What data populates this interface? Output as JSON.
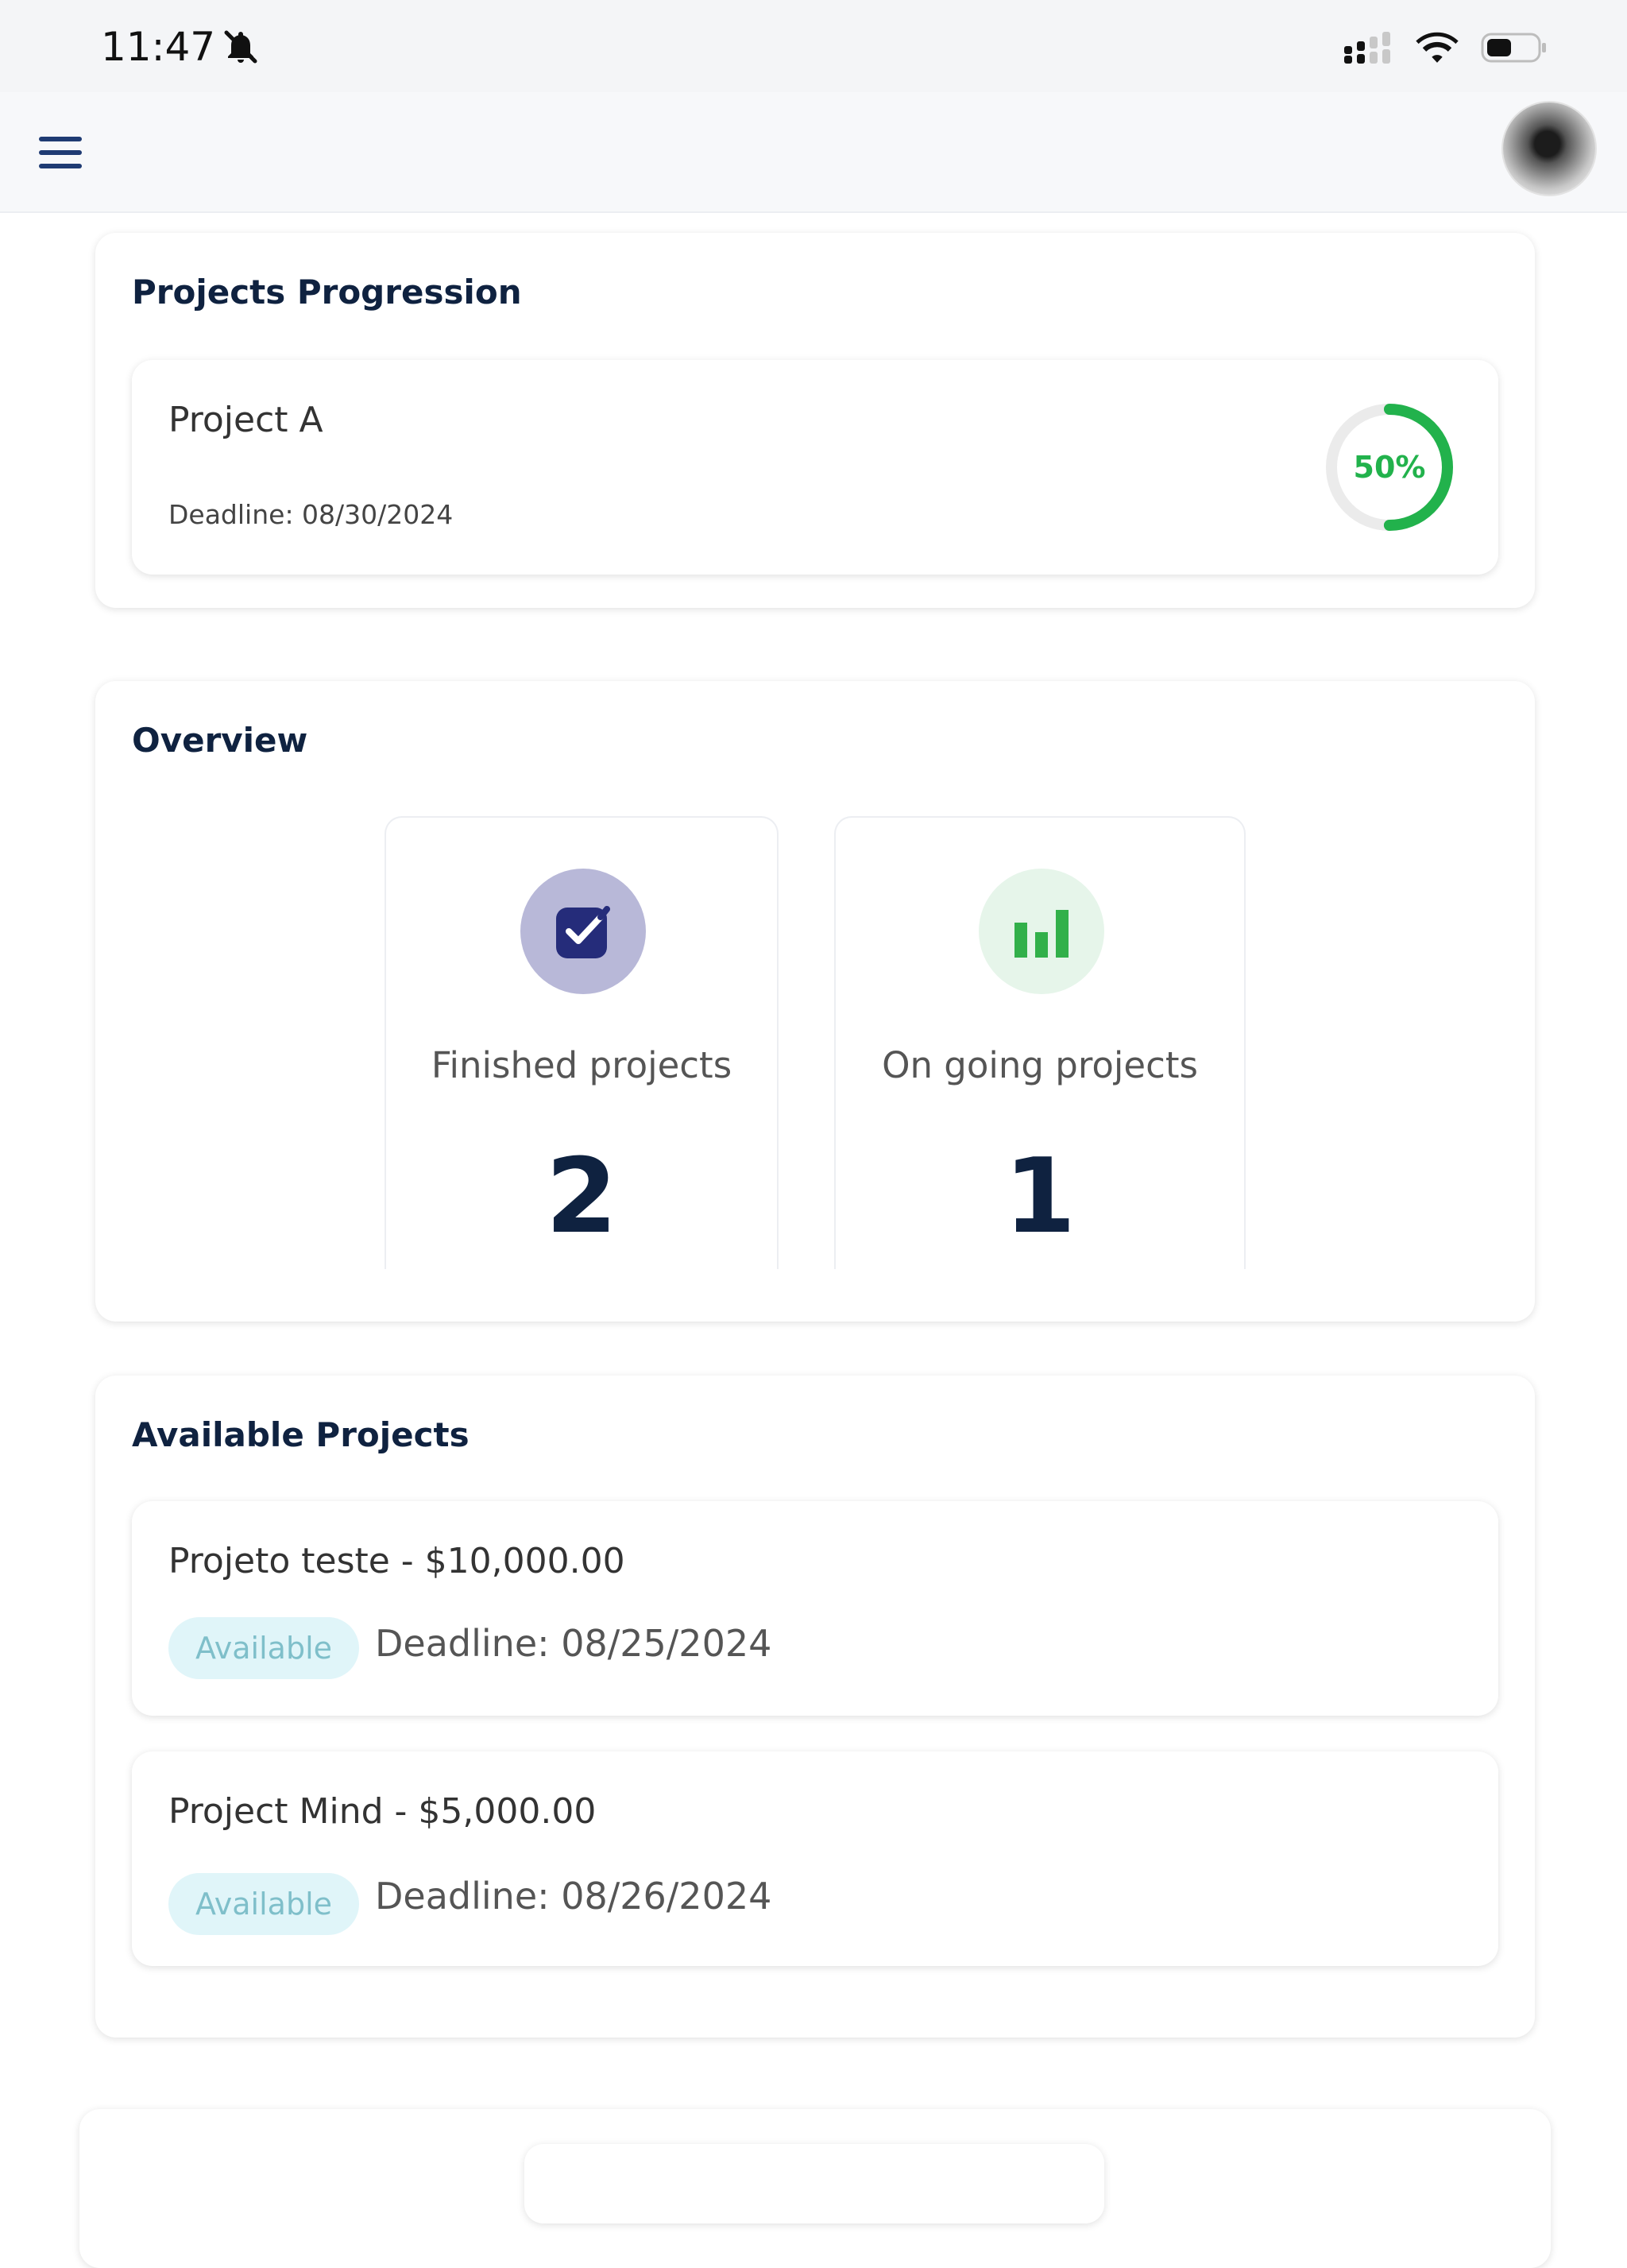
{
  "status_bar": {
    "time": "11:47",
    "icons": [
      "bell-off-icon",
      "signal-icon",
      "wifi-icon",
      "battery-icon"
    ]
  },
  "app_bar": {
    "menu_icon": "hamburger-menu-icon",
    "avatar": "user-avatar"
  },
  "projects_progression": {
    "title": "Projects Progression",
    "items": [
      {
        "name": "Project A",
        "deadline": "Deadline: 08/30/2024",
        "progress_label": "50%",
        "progress": 0.5
      }
    ]
  },
  "overview": {
    "title": "Overview",
    "stats": [
      {
        "label": "Finished projects",
        "value": "2",
        "icon": "checkbox-icon"
      },
      {
        "label": "On going projects",
        "value": "1",
        "icon": "bar-chart-icon"
      }
    ]
  },
  "available_projects": {
    "title": "Available Projects",
    "items": [
      {
        "title": "Projeto teste - $10,000.00",
        "status": "Available",
        "deadline": "Deadline: 08/25/2024"
      },
      {
        "title": "Project Mind - $5,000.00",
        "status": "Available",
        "deadline": "Deadline: 08/26/2024"
      }
    ]
  },
  "colors": {
    "primary_navy": "#0f2240",
    "accent_green": "#22b24c",
    "badge_bg": "#e0f5f9",
    "badge_text": "#7fbfca",
    "check_bg": "#b8b8d8",
    "check_fg": "#252c7a",
    "chart_bg": "#e6f5ea"
  }
}
